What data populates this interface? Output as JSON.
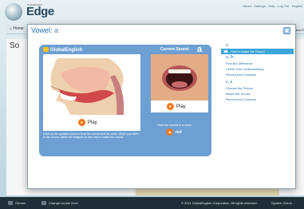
{
  "app": {
    "logo_small": "GlobalEnglish",
    "logo_name": "Edge",
    "top_links": "About · Settings · Help · Log Out · English",
    "nav_home": "Home",
    "nav_right": "New E",
    "bg_section": "So"
  },
  "footer": {
    "genres": "Genres",
    "change_level": "Change course level",
    "copyright": "© 2011 GlobalEnglish Corporation. All rights reserved.",
    "system_check": "System Check"
  },
  "modal": {
    "title_prefix": "Vowel:",
    "title_vowel": "a",
    "brand": "GlobalEnglish",
    "current_sound_label": "Current Sound:",
    "current_sound_value": "a",
    "play_label_left": "Play",
    "play_label_right": "Play",
    "instructions": "Click on the speaker icons to hear the sound and the word. When you listen to the sound, watch the diagram to see how to make the sound.",
    "hear_word": "Hear the sound in a word:",
    "word": "not"
  },
  "side_menu": {
    "groups": [
      {
        "heading": "a",
        "items": [
          {
            "label": "How to Make the Sound",
            "active": true
          }
        ]
      },
      {
        "heading": "a, 3r",
        "items": [
          {
            "label": "Find the Difference",
            "active": false
          },
          {
            "label": "Check Your Understanding",
            "active": false
          },
          {
            "label": "Record and Compare",
            "active": false
          }
        ]
      },
      {
        "heading": "ʌ, a",
        "items": [
          {
            "label": "Choose the Picture",
            "active": false
          },
          {
            "label": "Match the Sound",
            "active": false
          },
          {
            "label": "Record and Compare",
            "active": false
          }
        ]
      }
    ]
  },
  "colors": {
    "panel": "#6d9fd3",
    "accent_orange": "#f07a1a",
    "link_blue": "#1f6fb2",
    "active_item": "#3aa5d8"
  }
}
